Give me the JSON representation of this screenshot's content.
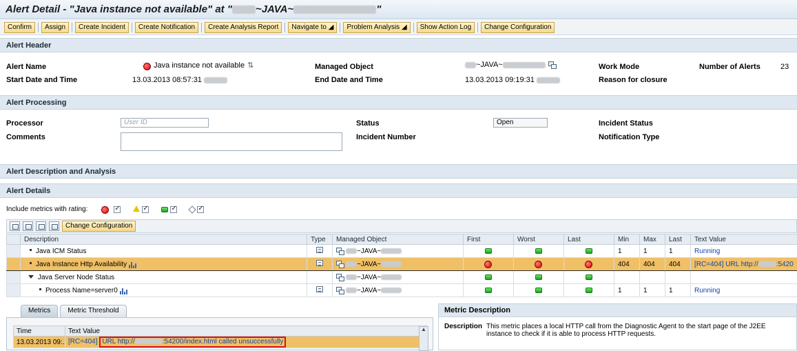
{
  "title": {
    "prefix": "Alert Detail - \"Java instance not available\" at \"",
    "middle": "~JAVA~",
    "suffix": "\""
  },
  "toolbar": {
    "buttons": [
      "Confirm",
      "Assign",
      "Create Incident",
      "Create Notification",
      "Create Analysis Report",
      "Navigate to ◢",
      "Problem Analysis ◢",
      "Show Action Log",
      "Change Configuration"
    ]
  },
  "alert_header": {
    "section_title": "Alert Header",
    "alert_name_label": "Alert Name",
    "alert_name_value": "Java instance not available",
    "start_label": "Start Date and Time",
    "start_value": "13.03.2013 08:57:31",
    "managed_object_label": "Managed Object",
    "managed_object_value": "~JAVA~",
    "end_label": "End Date and Time",
    "end_value": "13.03.2013 09:19:31",
    "work_mode_label": "Work Mode",
    "reason_label": "Reason for closure",
    "num_alerts_label": "Number of Alerts",
    "num_alerts_value": "23"
  },
  "alert_processing": {
    "section_title": "Alert Processing",
    "processor_label": "Processor",
    "processor_placeholder": "User ID",
    "comments_label": "Comments",
    "status_label": "Status",
    "status_value": "Open",
    "incident_number_label": "Incident Number",
    "incident_status_label": "Incident Status",
    "notification_type_label": "Notification Type"
  },
  "sections": {
    "description_analysis": "Alert Description and Analysis",
    "alert_details": "Alert Details"
  },
  "filter": {
    "label": "Include metrics with rating:"
  },
  "grid_toolbar": {
    "change_config": "Change Configuration"
  },
  "grid": {
    "columns": [
      "Description",
      "Type",
      "Managed Object",
      "First",
      "Worst",
      "Last",
      "Min",
      "Max",
      "Last",
      "Text Value"
    ],
    "rows": [
      {
        "desc": "Java ICM Status",
        "mo": "~JAVA~",
        "first": "green",
        "worst": "green",
        "last": "green",
        "min": "1",
        "max": "1",
        "lastv": "1",
        "text": "Running",
        "chart": false,
        "kind": "bullet",
        "type": true
      },
      {
        "desc": "Java Instance Http Availability",
        "mo": "~JAVA~",
        "first": "red",
        "worst": "red",
        "last": "red",
        "min": "404",
        "max": "404",
        "lastv": "404",
        "text": "[RC=404] URL http://",
        "text_tail": ":5420",
        "chart": true,
        "kind": "bullet",
        "type": true
      },
      {
        "desc": "Java Server Node Status",
        "mo": "~JAVA~",
        "first": "green",
        "worst": "green",
        "last": "green",
        "min": "",
        "max": "",
        "lastv": "",
        "text": "",
        "chart": false,
        "kind": "expand",
        "type": false
      },
      {
        "desc": "Process Name=server0",
        "mo": "~JAVA~",
        "first": "green",
        "worst": "green",
        "last": "green",
        "min": "1",
        "max": "1",
        "lastv": "1",
        "text": "Running",
        "chart": true,
        "kind": "bullet-indent",
        "type": true
      }
    ]
  },
  "tabs": [
    "Metrics",
    "Metric Threshold"
  ],
  "metrics_table": {
    "columns": [
      "Time",
      "Text Value"
    ],
    "row_time": "13.03.2013 09:...",
    "row_text_prefix": "[RC=404]",
    "row_text_url_a": "URL http://",
    "row_text_url_b": ":54200/index.html called unsuccessfully"
  },
  "metric_description": {
    "title": "Metric Description",
    "label": "Description",
    "text": "This metric places a local HTTP call from the Diagnostic Agent to the start page of the J2EE instance to check if it is able to process HTTP requests."
  }
}
